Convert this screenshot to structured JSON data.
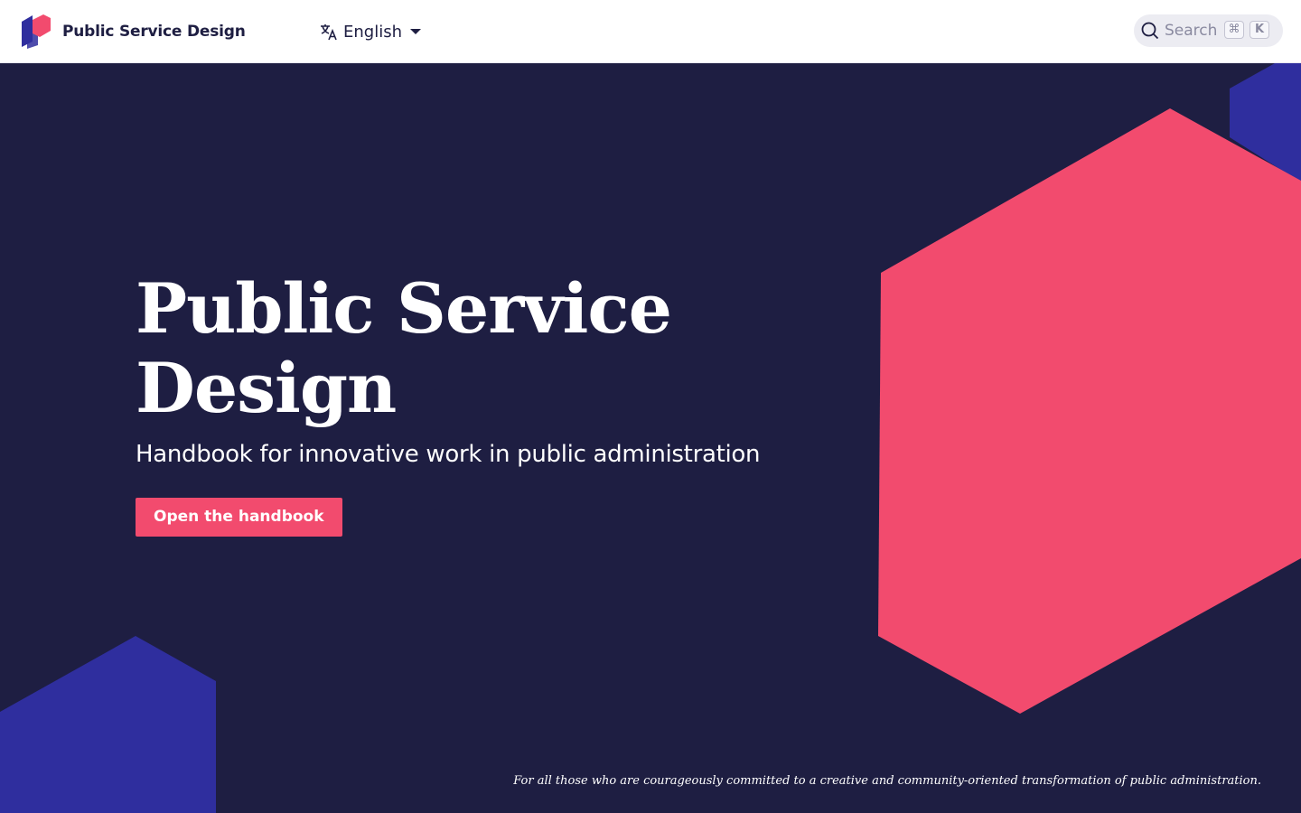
{
  "header": {
    "brand_name": "Public Service Design",
    "language": {
      "selected": "English"
    },
    "search": {
      "placeholder": "Search",
      "shortcut_modifier": "⌘",
      "shortcut_key": "K"
    }
  },
  "hero": {
    "title": "Public Service Design",
    "subtitle": "Handbook for innovative work in public administration",
    "cta_label": "Open the handbook",
    "tagline": "For all those who are courageously committed to a creative and community-oriented transformation of public administration."
  },
  "colors": {
    "background": "#1e1e42",
    "accent_pink": "#f24b6e",
    "accent_blue": "#2f2e9e",
    "header_bg": "#ffffff"
  },
  "icons": {
    "logo": "hexagon-stack-logo-icon",
    "language": "translate-icon",
    "caret": "caret-down-icon",
    "search": "search-icon"
  }
}
